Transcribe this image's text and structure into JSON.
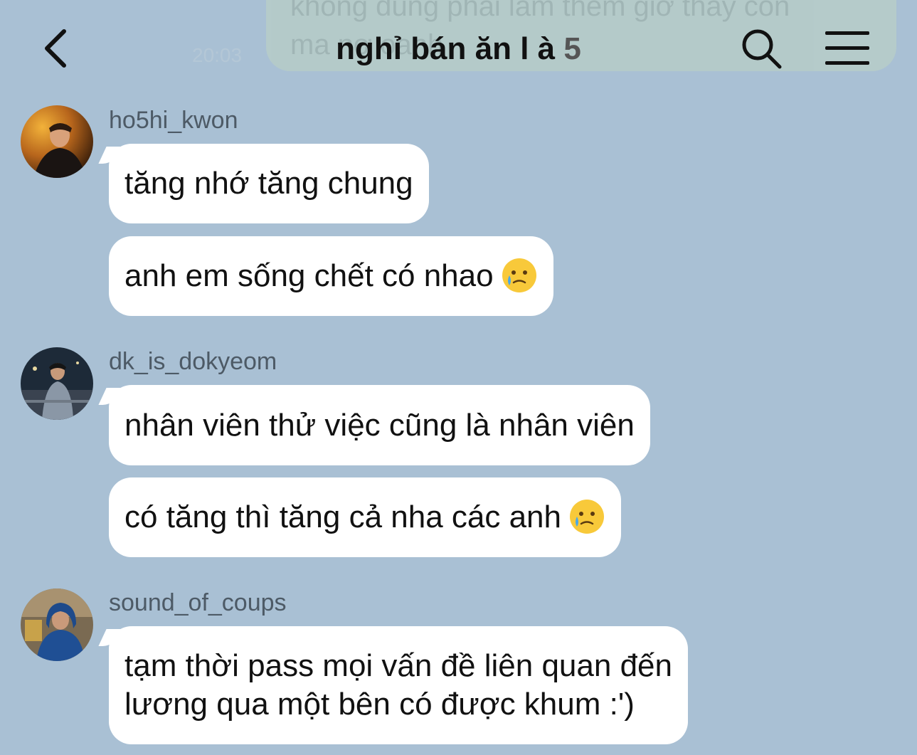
{
  "header": {
    "title": "nghỉ bán ăn l à",
    "member_count": "5",
    "back_icon": "chevron-left-icon",
    "search_icon": "search-icon",
    "menu_icon": "menu-icon"
  },
  "previous_message": {
    "text": "không đúng phải làm thêm giờ thay con\nma nợ oanh",
    "time": "20:03"
  },
  "messages": [
    {
      "sender": "ho5hi_kwon",
      "bubbles": [
        {
          "text": "tăng nhớ tăng chung",
          "emoji": ""
        },
        {
          "text": "anh em sống chết có nhao",
          "emoji": "crying-face-emoji"
        }
      ]
    },
    {
      "sender": "dk_is_dokyeom",
      "bubbles": [
        {
          "text": "nhân viên thử việc cũng là nhân viên",
          "emoji": ""
        },
        {
          "text": "có tăng thì tăng cả nha các anh",
          "emoji": "crying-face-emoji"
        }
      ]
    },
    {
      "sender": "sound_of_coups",
      "bubbles": [
        {
          "text": "tạm thời pass mọi vấn đề liên quan đến\nlương qua một bên có được khum :')",
          "emoji": ""
        }
      ]
    }
  ],
  "colors": {
    "background": "#a9c0d4",
    "bubble": "#ffffff",
    "sender_name": "#4d5a66"
  }
}
